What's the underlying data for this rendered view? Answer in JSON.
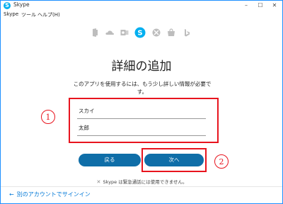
{
  "window": {
    "title": "Skype",
    "minimize_glyph": "–",
    "maximize_glyph": "☐",
    "close_glyph": "✕"
  },
  "menu": [
    "Skype",
    "ツール",
    "ヘルプ(H)"
  ],
  "icons": [
    "office-icon",
    "onedrive-icon",
    "outlook-icon",
    "skype-icon",
    "xbox-icon",
    "store-icon",
    "bing-icon"
  ],
  "main": {
    "heading": "詳細の追加",
    "description_line1": "このアプリを使用するには、もう少し詳しい情報が必要で",
    "description_line2": "す。",
    "last_name_value": "スカイ",
    "first_name_value": "太郎",
    "back_button": "戻る",
    "next_button": "次へ",
    "emergency_notice": "Skype は緊急通話には使用できません。",
    "marker_1": "1",
    "marker_2": "2"
  },
  "footer": {
    "signin_other": "別のアカウントでサインイン",
    "arrow": "←"
  },
  "colors": {
    "accent": "#0f6ea8",
    "skype_blue": "#00aff0",
    "annotation_red": "#e8141e",
    "link": "#0078d7"
  }
}
